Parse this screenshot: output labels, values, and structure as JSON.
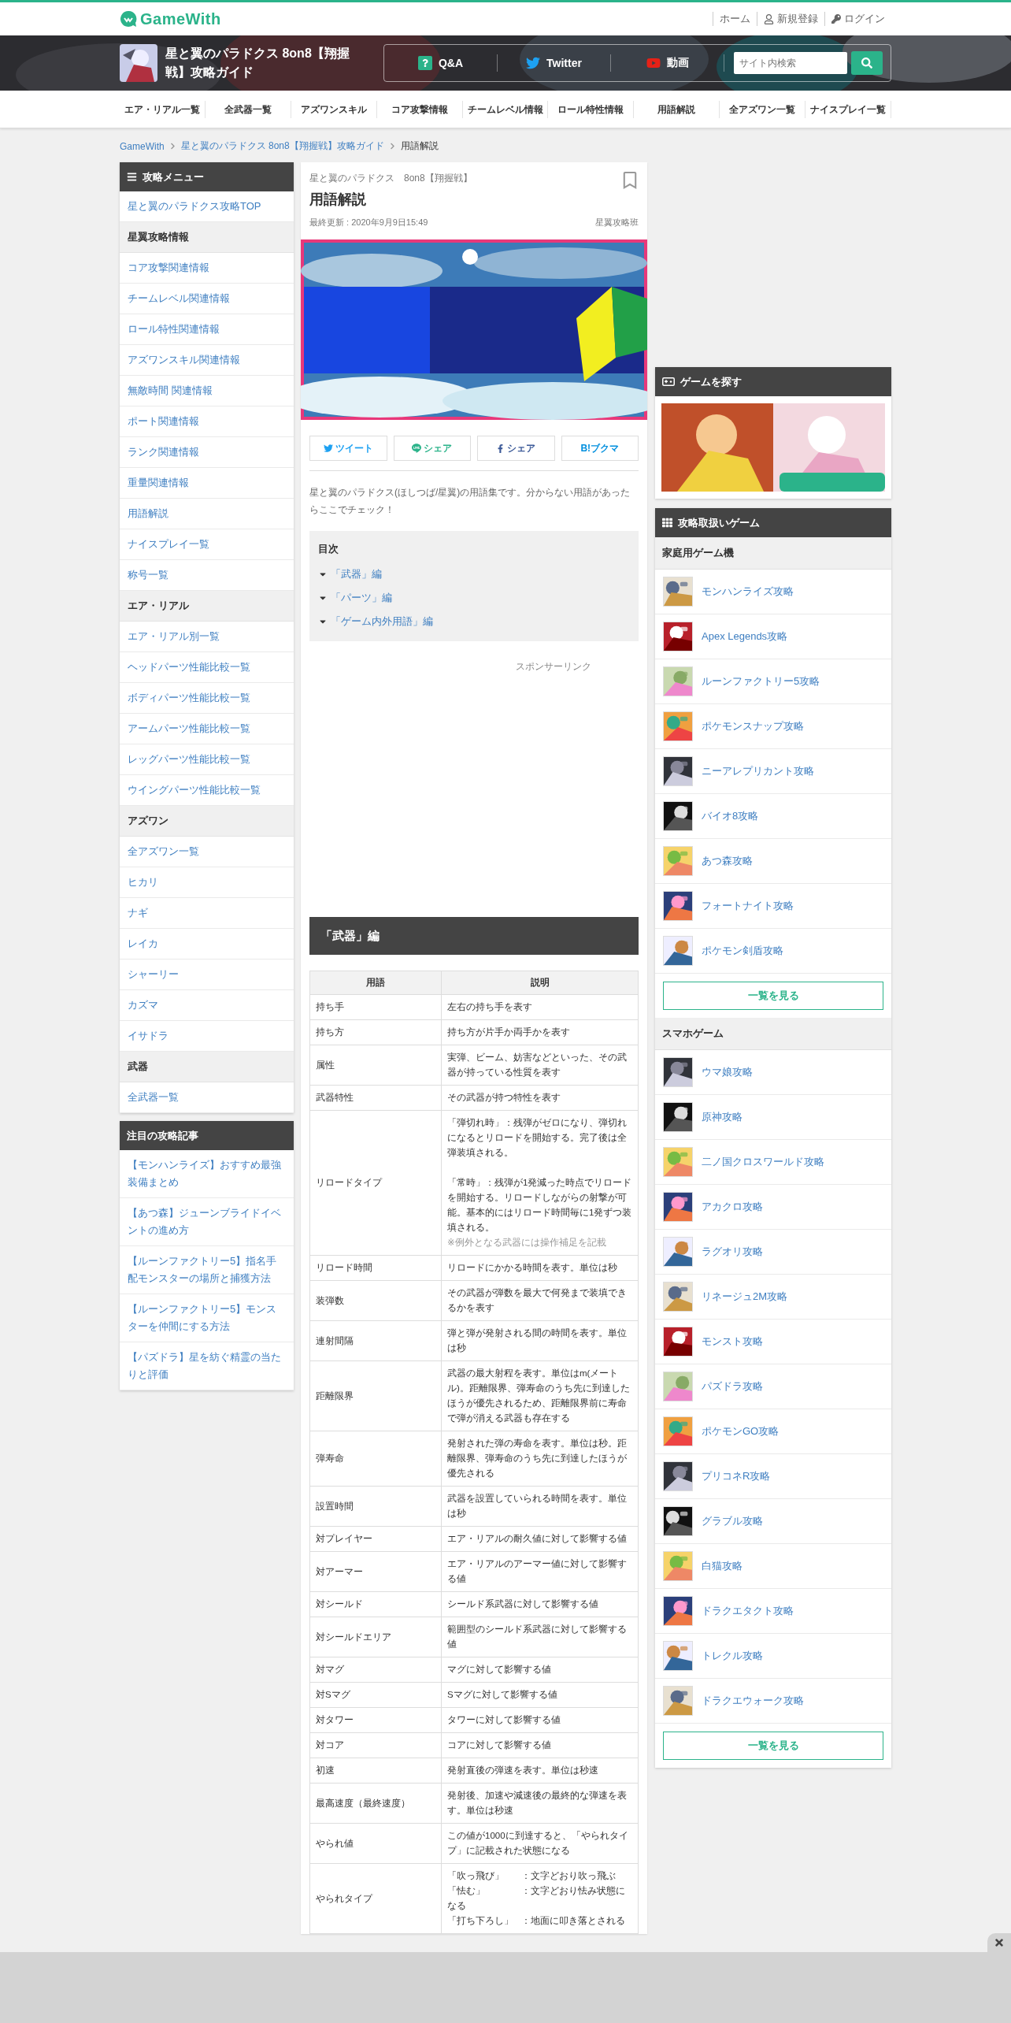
{
  "header": {
    "logo": "GameWith",
    "links": [
      {
        "label": "ホーム",
        "kind": "plain"
      },
      {
        "label": "新規登録",
        "kind": "user"
      },
      {
        "label": "ログイン",
        "kind": "key"
      }
    ]
  },
  "banner": {
    "title": "星と翼のパラドクス 8on8【翔握戦】攻略ガイド",
    "links": [
      {
        "label": "Q&A",
        "kind": "qa"
      },
      {
        "label": "Twitter",
        "kind": "twitter"
      },
      {
        "label": "動画",
        "kind": "video"
      }
    ],
    "search": {
      "placeholder": "サイト内検索"
    }
  },
  "nav": [
    "エア・リアル一覧",
    "全武器一覧",
    "アズワンスキル",
    "コア攻撃情報",
    "チームレベル情報",
    "ロール特性情報",
    "用語解説",
    "全アズワン一覧",
    "ナイスプレイ一覧"
  ],
  "breadcrumb": [
    "GameWith",
    "星と翼のパラドクス 8on8【翔握戦】攻略ガイド",
    "用語解説"
  ],
  "left_menu": {
    "title": "攻略メニュー",
    "sections": [
      {
        "items": [
          "星と翼のパラドクス攻略TOP"
        ]
      },
      {
        "heading": "星翼攻略情報",
        "items": [
          "コア攻撃関連情報",
          "チームレベル関連情報",
          "ロール特性関連情報",
          "アズワンスキル関連情報",
          "無敵時間 関連情報",
          "ポート関連情報",
          "ランク関連情報",
          "重量関連情報",
          "用語解説",
          "ナイスプレイ一覧",
          "称号一覧"
        ]
      },
      {
        "heading": "エア・リアル",
        "items": [
          "エア・リアル別一覧",
          "ヘッドパーツ性能比較一覧",
          "ボディパーツ性能比較一覧",
          "アームパーツ性能比較一覧",
          "レッグパーツ性能比較一覧",
          "ウイングパーツ性能比較一覧"
        ]
      },
      {
        "heading": "アズワン",
        "items": [
          "全アズワン一覧",
          "ヒカリ",
          "ナギ",
          "レイカ",
          "シャーリー",
          "カズマ",
          "イサドラ"
        ]
      },
      {
        "heading": "武器",
        "items": [
          "全武器一覧"
        ]
      }
    ]
  },
  "featured": {
    "title": "注目の攻略記事",
    "items": [
      "【モンハンライズ】おすすめ最強装備まとめ",
      "【あつ森】ジューンブライドイベントの進め方",
      "【ルーンファクトリー5】指名手配モンスターの場所と捕獲方法",
      "【ルーンファクトリー5】モンスターを仲間にする方法",
      "【パズドラ】星を紡ぐ精霊の当たりと評価"
    ]
  },
  "article": {
    "series": "星と翼のパラドクス　8on8【翔握戦】",
    "title": "用語解説",
    "updated": "最終更新 : 2020年9月9日15:49",
    "author": "星翼攻略班",
    "share": [
      {
        "label": "ツイート",
        "kind": "twitter"
      },
      {
        "label": "シェア",
        "kind": "line"
      },
      {
        "label": "シェア",
        "kind": "facebook"
      },
      {
        "label": "**B!**ブクマ",
        "kind": "hatena"
      }
    ],
    "intro": "星と翼のパラドクス(ほしつば/星翼)の用語集です。分からない用語があったらここでチェック！",
    "toc": {
      "title": "目次",
      "items": [
        "「武器」編",
        "「パーツ」編",
        "「ゲーム内外用語」編"
      ]
    },
    "sponsor": "スポンサーリンク",
    "section_title": "「武器」編",
    "table": {
      "columns": [
        "用語",
        "説明"
      ],
      "rows": [
        {
          "term": "持ち手",
          "description": [
            {
              "kind": "text",
              "text": "左右の持ち手を表す"
            }
          ]
        },
        {
          "term": "持ち方",
          "description": [
            {
              "kind": "text",
              "text": "持ち方が片手か両手かを表す"
            }
          ]
        },
        {
          "term": "属性",
          "description": [
            {
              "kind": "text",
              "text": "実弾、ビーム、妨害などといった、その武器が持っている性質を表す"
            }
          ]
        },
        {
          "term": "武器特性",
          "description": [
            {
              "kind": "text",
              "text": "その武器が持つ特性を表す"
            }
          ]
        },
        {
          "term": "リロードタイプ",
          "description": [
            {
              "kind": "text",
              "text": "「弾切れ時」：残弾がゼロになり、弾切れになるとリロードを開始する。完了後は全弾装填される。"
            },
            {
              "kind": "text",
              "text": "「常時」：残弾が1発減った時点でリロードを開始する。リロードしながらの射撃が可能。基本的にはリロード時間毎に1発ずつ装填される。"
            },
            {
              "kind": "note",
              "text": "※例外となる武器には操作補足を記載"
            }
          ]
        },
        {
          "term": "リロード時間",
          "description": [
            {
              "kind": "text",
              "text": "リロードにかかる時間を表す。単位は秒"
            }
          ]
        },
        {
          "term": "装弾数",
          "description": [
            {
              "kind": "text",
              "text": "その武器が弾数を最大で何発まで装填できるかを表す"
            }
          ]
        },
        {
          "term": "連射間隔",
          "description": [
            {
              "kind": "text",
              "text": "弾と弾が発射される間の時間を表す。単位は秒"
            }
          ]
        },
        {
          "term": "距離限界",
          "description": [
            {
              "kind": "text",
              "text": "武器の最大射程を表す。単位はm(メートル)。距離限界、弾寿命のうち先に到達したほうが優先されるため、距離限界前に寿命で弾が消える武器も存在する"
            }
          ]
        },
        {
          "term": "弾寿命",
          "description": [
            {
              "kind": "text",
              "text": "発射された弾の寿命を表す。単位は秒。距離限界、弾寿命のうち先に到達したほうが優先される"
            }
          ]
        },
        {
          "term": "設置時間",
          "description": [
            {
              "kind": "text",
              "text": "武器を設置していられる時間を表す。単位は秒"
            }
          ]
        },
        {
          "term": "対プレイヤー",
          "description": [
            {
              "kind": "text",
              "text": "エア・リアルの耐久値に対して影響する値"
            }
          ]
        },
        {
          "term": "対アーマー",
          "description": [
            {
              "kind": "text",
              "text": "エア・リアルのアーマー値に対して影響する値"
            }
          ]
        },
        {
          "term": "対シールド",
          "description": [
            {
              "kind": "text",
              "text": "シールド系武器に対して影響する値"
            }
          ]
        },
        {
          "term": "対シールドエリア",
          "description": [
            {
              "kind": "text",
              "text": "範囲型のシールド系武器に対して影響する値"
            }
          ]
        },
        {
          "term": "対マグ",
          "description": [
            {
              "kind": "text",
              "text": "マグに対して影響する値"
            }
          ]
        },
        {
          "term": "対Sマグ",
          "description": [
            {
              "kind": "text",
              "text": "Sマグに対して影響する値"
            }
          ]
        },
        {
          "term": "対タワー",
          "description": [
            {
              "kind": "text",
              "text": "タワーに対して影響する値"
            }
          ]
        },
        {
          "term": "対コア",
          "description": [
            {
              "kind": "text",
              "text": "コアに対して影響する値"
            }
          ]
        },
        {
          "term": "初速",
          "description": [
            {
              "kind": "text",
              "text": "発射直後の弾速を表す。単位は秒速"
            }
          ]
        },
        {
          "term": "最高速度（最終速度）",
          "description": [
            {
              "kind": "text",
              "text": "発射後、加速や減速後の最終的な弾速を表す。単位は秒速"
            }
          ]
        },
        {
          "term": "やられ値",
          "description": [
            {
              "kind": "text",
              "text": "この値が1000に到達すると、「やられタイプ」に記載された状態になる"
            }
          ]
        },
        {
          "term": "やられタイプ",
          "description": [
            {
              "kind": "pair",
              "label": "「吹っ飛び」",
              "text": "：文字どおり吹っ飛ぶ"
            },
            {
              "kind": "pair",
              "label": "「怯む」",
              "text": "：文字どおり怯み状態になる"
            },
            {
              "kind": "pair",
              "label": "「打ち下ろし」",
              "text": "：地面に叩き落とされる"
            }
          ]
        }
      ]
    }
  },
  "right": {
    "find": {
      "title": "ゲームを探す"
    },
    "games": {
      "title": "攻略取扱いゲーム",
      "groups": [
        {
          "heading": "家庭用ゲーム機",
          "items": [
            "モンハンライズ攻略",
            "Apex Legends攻略",
            "ルーンファクトリー5攻略",
            "ポケモンスナップ攻略",
            "ニーアレプリカント攻略",
            "バイオ8攻略",
            "あつ森攻略",
            "フォートナイト攻略",
            "ポケモン剣盾攻略"
          ],
          "more": "一覧を見る"
        },
        {
          "heading": "スマホゲーム",
          "items": [
            "ウマ娘攻略",
            "原神攻略",
            "二ノ国クロスワールド攻略",
            "アカクロ攻略",
            "ラグオリ攻略",
            "リネージュ2M攻略",
            "モンスト攻略",
            "パズドラ攻略",
            "ポケモンGO攻略",
            "プリコネR攻略",
            "グラブル攻略",
            "白猫攻略",
            "ドラクエタクト攻略",
            "トレクル攻略",
            "ドラクエウォーク攻略"
          ],
          "more": "一覧を見る"
        }
      ]
    }
  }
}
